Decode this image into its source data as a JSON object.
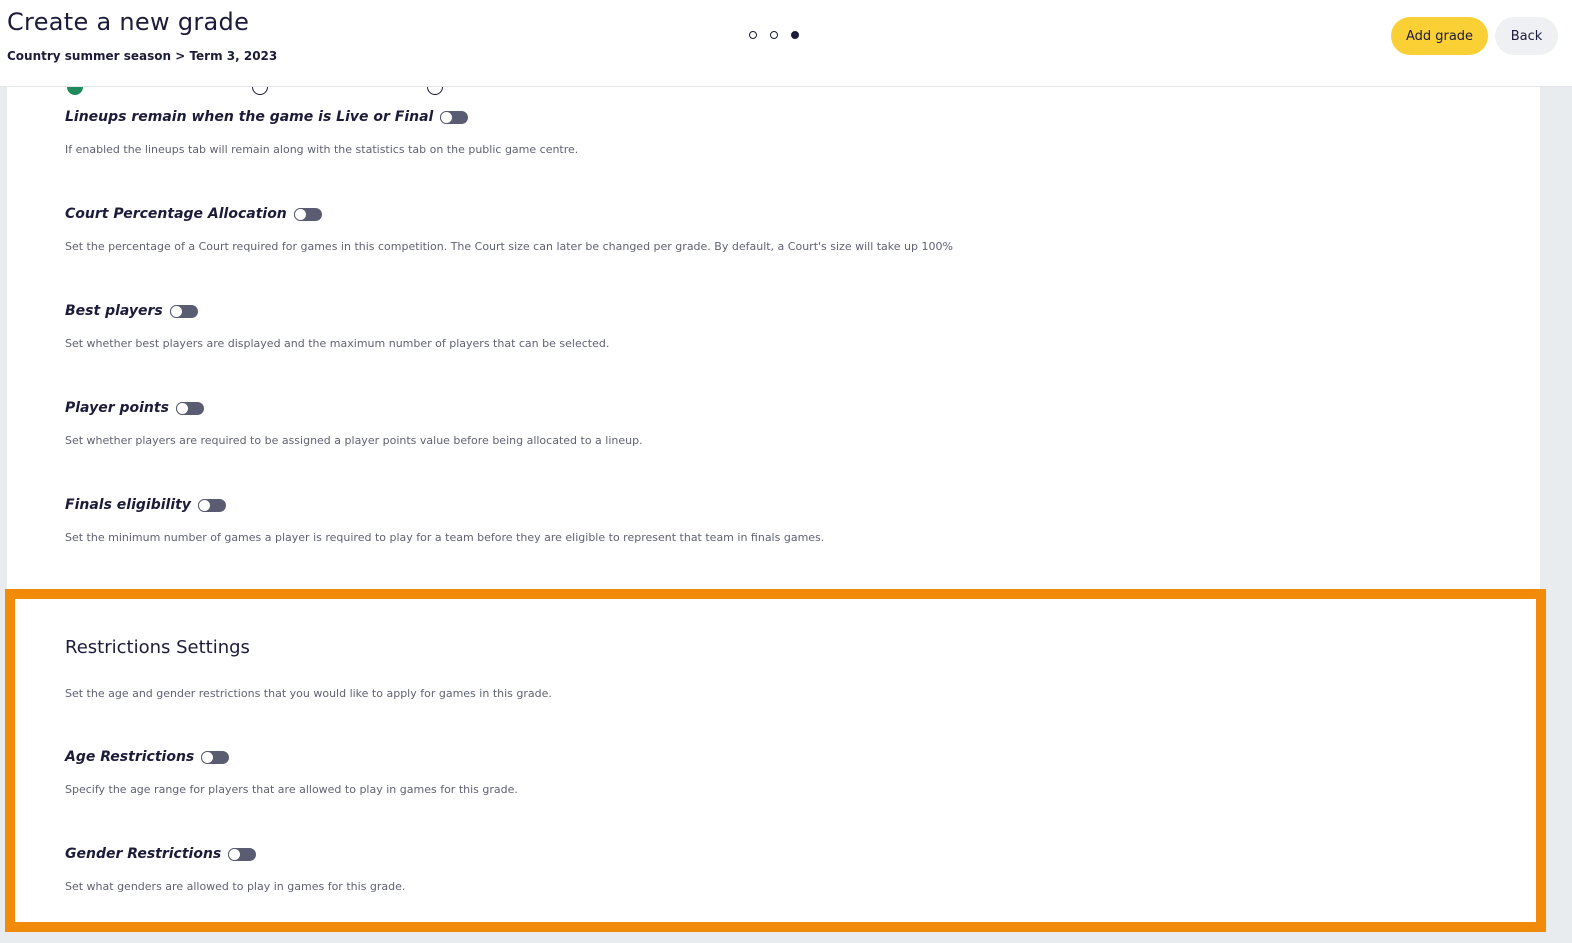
{
  "header": {
    "title": "Create a new grade",
    "breadcrumb": "Country summer season > Term 3, 2023",
    "add_grade_label": "Add grade",
    "back_label": "Back",
    "steps_total": 3,
    "steps_current": 3
  },
  "settings": [
    {
      "title": "Lineups remain when the game is Live or Final",
      "description": "If enabled the lineups tab will remain along with the statistics tab on the public game centre.",
      "enabled": false
    },
    {
      "title": "Court Percentage Allocation",
      "description": "Set the percentage of a Court required for games in this competition. The Court size can later be changed per grade. By default, a Court's size will take up 100%",
      "enabled": false
    },
    {
      "title": "Best players",
      "description": "Set whether best players are displayed and the maximum number of players that can be selected.",
      "enabled": false
    },
    {
      "title": "Player points",
      "description": "Set whether players are required to be assigned a player points value before being allocated to a lineup.",
      "enabled": false
    },
    {
      "title": "Finals eligibility",
      "description": "Set the minimum number of games a player is required to play for a team before they are eligible to represent that team in finals games.",
      "enabled": false
    }
  ],
  "restrictions": {
    "title": "Restrictions Settings",
    "description": "Set the age and gender restrictions that you would like to apply for games in this grade.",
    "items": [
      {
        "title": "Age Restrictions",
        "description": "Specify the age range for players that are allowed to play in games for this grade.",
        "enabled": false
      },
      {
        "title": "Gender Restrictions",
        "description": "Set what genders are allowed to play in games for this grade.",
        "enabled": false
      }
    ]
  },
  "colors": {
    "accent": "#fbd035",
    "highlight_border": "#f28a0a",
    "toggle_off": "#5a5d72",
    "radio_selected": "#1f8a5b"
  }
}
